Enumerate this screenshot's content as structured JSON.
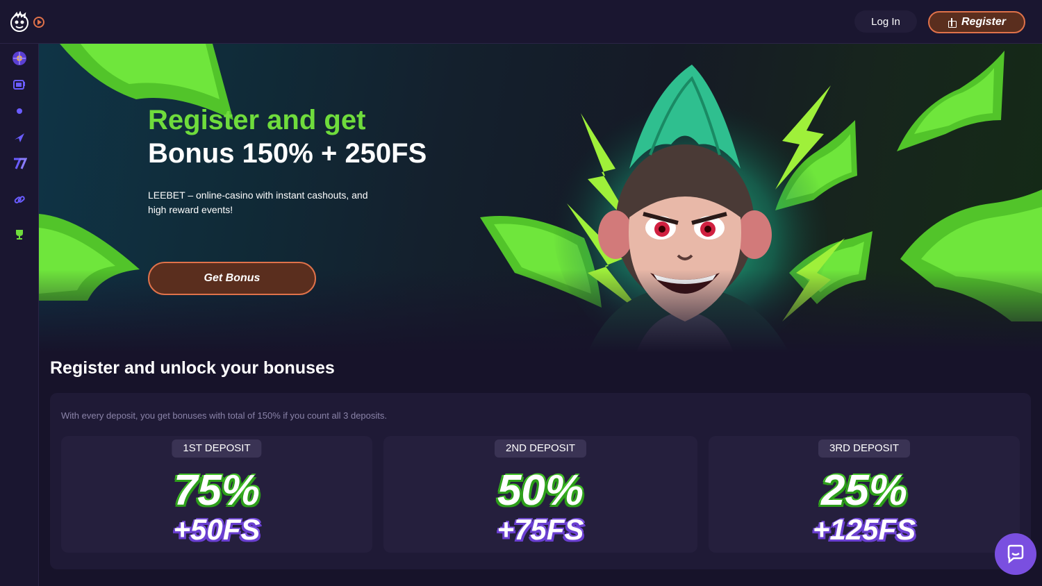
{
  "header": {
    "login_label": "Log In",
    "register_label": "Register"
  },
  "sidebar": {
    "items": [
      {
        "icon": "wheel-icon",
        "color": "#8a6bff"
      },
      {
        "icon": "slots-icon",
        "color": "#6a5cff"
      },
      {
        "icon": "live-dot-icon",
        "color": "#6a5cff"
      },
      {
        "icon": "plane-icon",
        "color": "#6a5cff"
      },
      {
        "icon": "seven-icon",
        "color": "#6a5cff"
      },
      {
        "icon": "link-icon",
        "color": "#6a5cff"
      },
      {
        "icon": "trophy-icon",
        "color": "#6fdc3c"
      }
    ]
  },
  "hero": {
    "title_green": "Register and get",
    "title_white": "Bonus 150% + 250FS",
    "description": "LEEBET – online-casino with instant cashouts, and high reward events!",
    "cta_label": "Get Bonus"
  },
  "bonuses": {
    "section_title": "Register and unlock your bonuses",
    "note": "With every deposit, you get bonuses with total of 150% if you count all 3 deposits.",
    "deposits": [
      {
        "label": "1ST DEPOSIT",
        "percent": "75%",
        "freespins": "+50FS"
      },
      {
        "label": "2ND DEPOSIT",
        "percent": "50%",
        "freespins": "+75FS"
      },
      {
        "label": "3RD DEPOSIT",
        "percent": "25%",
        "freespins": "+125FS"
      }
    ]
  },
  "colors": {
    "accent_orange": "#e0724a",
    "accent_green": "#6fdc3c",
    "accent_purple": "#7a4fe0",
    "background": "#17132a"
  }
}
